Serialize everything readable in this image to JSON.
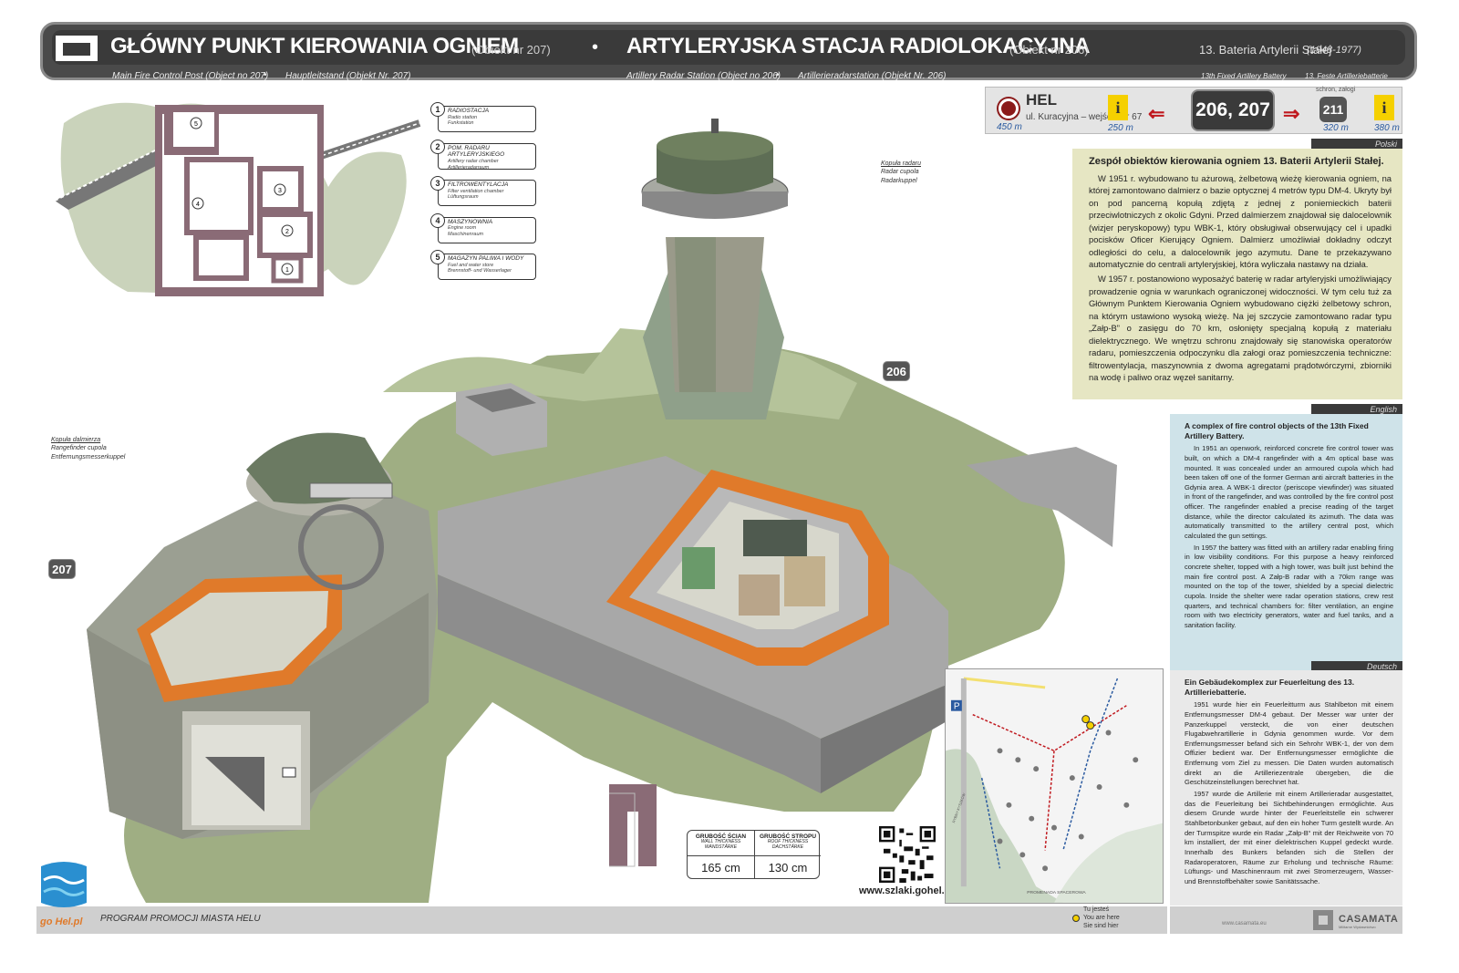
{
  "header": {
    "title_1": "GŁÓWNY PUNKT KIEROWANIA OGNIEM",
    "obj_1": "(Obiekt nr 207)",
    "title_2": "ARTYLERYJSKA STACJA RADIOLOKACYJNA",
    "obj_2": "(Obiekt nr 206)",
    "battery": "13. Bateria Artylerii Stałej",
    "battery_years": "(1948-1977)",
    "dot": "•",
    "sub_en_1": "Main Fire Control Post (Object no 207)",
    "sub_de_1": "Hauptleitstand (Objekt Nr. 207)",
    "sub_en_2": "Artillery Radar Station (Object no 206)",
    "sub_de_2": "Artillerieradarstation (Objekt Nr. 206)",
    "sub_battery_en": "13th Fixed Artillery Battery",
    "sub_battery_de": "13. Feste Artilleriebatterie"
  },
  "nav": {
    "place": "HEL",
    "address": "ul. Kuracyjna – wejście nr 67",
    "dist_place": "450 m",
    "dist_info_1": "250 m",
    "current": "206, 207",
    "next_label": "schron, załogi",
    "next": "211",
    "dist_next": "320 m",
    "dist_info_2": "380 m",
    "info_symbol": "i",
    "arrow_left": "⇐",
    "arrow_right": "⇒"
  },
  "panels": {
    "pl": {
      "tab": "Polski",
      "title": "Zespół obiektów kierowania ogniem 13. Baterii Artylerii Stałej.",
      "p1": "W 1951 r. wybudowano tu ażurową, żelbetową wieżę kierowania ogniem, na której zamontowano dalmierz o bazie optycznej 4 metrów typu DM-4. Ukryty był on pod pancerną kopułą zdjętą z jednej z poniemieckich baterii przeciwlotniczych z okolic Gdyni. Przed dalmierzem znajdował się dalocelownik (wizjer peryskopowy) typu WBK-1, który obsługiwał obserwujący cel i upadki pocisków Oficer Kierujący Ogniem. Dalmierz umożliwiał dokładny odczyt odległości do celu, a dalocelownik jego azymutu. Dane te przekazywano automatycznie do centrali artyleryjskiej, która wyliczała nastawy na działa.",
      "p2": "W 1957 r. postanowiono wyposażyć baterię w radar artyleryjski umożliwiający prowadzenie ognia w warunkach ograniczonej widoczności. W tym celu tuż za Głównym Punktem Kierowania Ogniem wybudowano ciężki żelbetowy schron, na którym ustawiono wysoką wieżę. Na jej szczycie zamontowano radar typu „Załp-B” o zasięgu do 70 km, osłonięty specjalną kopułą z materiału dielektrycznego. We wnętrzu schronu znajdowały się stanowiska operatorów radaru, pomieszczenia odpoczynku dla załogi oraz pomieszczenia techniczne: filtrowentylacja, maszynownia z dwoma agregatami prądotwórczymi, zbiorniki na wodę i paliwo oraz węzeł sanitarny."
    },
    "en": {
      "tab": "English",
      "title": "A complex of fire control objects of the 13th Fixed Artillery Battery.",
      "p1": "In 1951 an openwork, reinforced concrete fire control tower was built, on which a DM-4 rangefinder with a 4m optical base was mounted. It was concealed under an armoured cupola which had been taken off one of the former German anti aircraft batteries in the Gdynia area. A WBK-1 director (periscope viewfinder) was situated in front of the rangefinder, and was controlled by the fire control post officer. The rangefinder enabled a precise reading of the target distance, while the director calculated its azimuth. The data was automatically transmitted to the artillery central post, which calculated the gun settings.",
      "p2": "In 1957 the battery was fitted with an artillery radar enabling firing in low visibility conditions. For this purpose a heavy reinforced concrete shelter, topped with a high tower, was built just behind the main fire control post. A Załp-B radar with a 70km range was mounted on the top of the tower, shielded by a special dielectric cupola. Inside the shelter were radar operation stations, crew rest quarters, and technical chambers for: filter ventilation, an engine room with two electricity generators, water and fuel tanks, and a sanitation facility."
    },
    "de": {
      "tab": "Deutsch",
      "title": "Ein Gebäudekomplex zur Feuerleitung des 13. Artilleriebatterie.",
      "p1": "1951 wurde hier ein Feuerleitturm aus Stahlbeton mit einem Entfernungsmesser DM-4 gebaut. Der Messer war unter der Panzerkuppel versteckt, die von einer deutschen Flugabwehrartillerie in Gdynia genommen wurde. Vor dem Entfernungsmesser befand sich ein Sehrohr WBK-1, der von dem Offizier bedient war. Der Entfernungsmesser ermöglichte die Entfernung vom Ziel zu messen. Die Daten wurden automatisch direkt an die Artilleriezentrale übergeben, die die Geschützeinstellungen berechnet hat.",
      "p2": "1957 wurde die Artillerie mit einem Artillerieradar ausgestattet, das die Feuerleitung bei Sichtbehinderungen ermöglichte. Aus diesem Grunde wurde hinter der Feuerleitstelle ein schwerer Stahlbetonbunker gebaut, auf den ein hoher Turm gestellt wurde. An der Turmspitze wurde ein Radar „Załp-B“ mit der Reichweite von 70 km installiert, der mit einer dielektrischen Kuppel gedeckt wurde. Innerhalb des Bunkers befanden sich die Stellen der Radaroperatoren, Räume zur Erholung und technische Räume: Lüftungs- und Maschinenraum mit zwei Stromerzeugern, Wasser- und Brennstoffbehälter sowie Sanitätssache."
    }
  },
  "legend": [
    {
      "num": "1",
      "pl": "RADIOSTACJA",
      "en": "Radio station",
      "de": "Funkstation"
    },
    {
      "num": "2",
      "pl": "POM. RADARU ARTYLERYJSKIEGO",
      "en": "Artillery radar chamber",
      "de": "Artillerieradarraum"
    },
    {
      "num": "3",
      "pl": "FILTROWENTYLACJA",
      "en": "Filter ventilation chamber",
      "de": "Lüftungsraum"
    },
    {
      "num": "4",
      "pl": "MASZYNOWNIA",
      "en": "Engine room",
      "de": "Maschinenraum"
    },
    {
      "num": "5",
      "pl": "MAGAZYN PALIWA I WODY",
      "en": "Fuel and water store",
      "de": "Brennstoff- und Wasserlager"
    }
  ],
  "callouts": {
    "radar_pl": "Kopuła radaru",
    "radar_en": "Radar cupola",
    "radar_de": "Radarkuppel",
    "range_pl": "Kopuła dalmierza",
    "range_en": "Rangefinder cupola",
    "range_de": "Entfernungsmesserkuppel",
    "tag_206": "206",
    "tag_207": "207"
  },
  "thickness": {
    "wall_pl": "GRUBOŚĆ ŚCIAN",
    "wall_en": "WALL THICKNESS",
    "wall_de": "WANDSTÄRKE",
    "wall_val": "165 cm",
    "roof_pl": "GRUBOŚĆ STROPU",
    "roof_en": "ROOF THICKNESS",
    "roof_de": "DACHSTÄRKE",
    "roof_val": "130 cm"
  },
  "url": "www.szlaki.gohel.pl",
  "footer": {
    "program": "PROGRAM PROMOCJI MIASTA HELU",
    "you_pl": "Tu jesteś",
    "you_en": "You are here",
    "you_de": "Sie sind hier",
    "casamata": "CASAMATA",
    "casamata_sub": "Militarne Wydawnictwo",
    "casamata_url": "www.casamata.eu",
    "gohel": "go Hel.pl"
  },
  "map_labels": {
    "p": "P",
    "promenade": "PROMENADA SPACEROWA",
    "kyszkow": "RYBNY KYSZKÓW"
  },
  "colors": {
    "header_bg": "#4a4a4a",
    "panel_pl": "#e6e6c3",
    "panel_en": "#cfe3e9",
    "panel_de": "#e9e9e9",
    "grass": "#9fae83",
    "concrete": "#a8a8a8",
    "cutaway": "#e07a2a",
    "accent_red": "#c0181e",
    "info_yellow": "#f5d000"
  }
}
